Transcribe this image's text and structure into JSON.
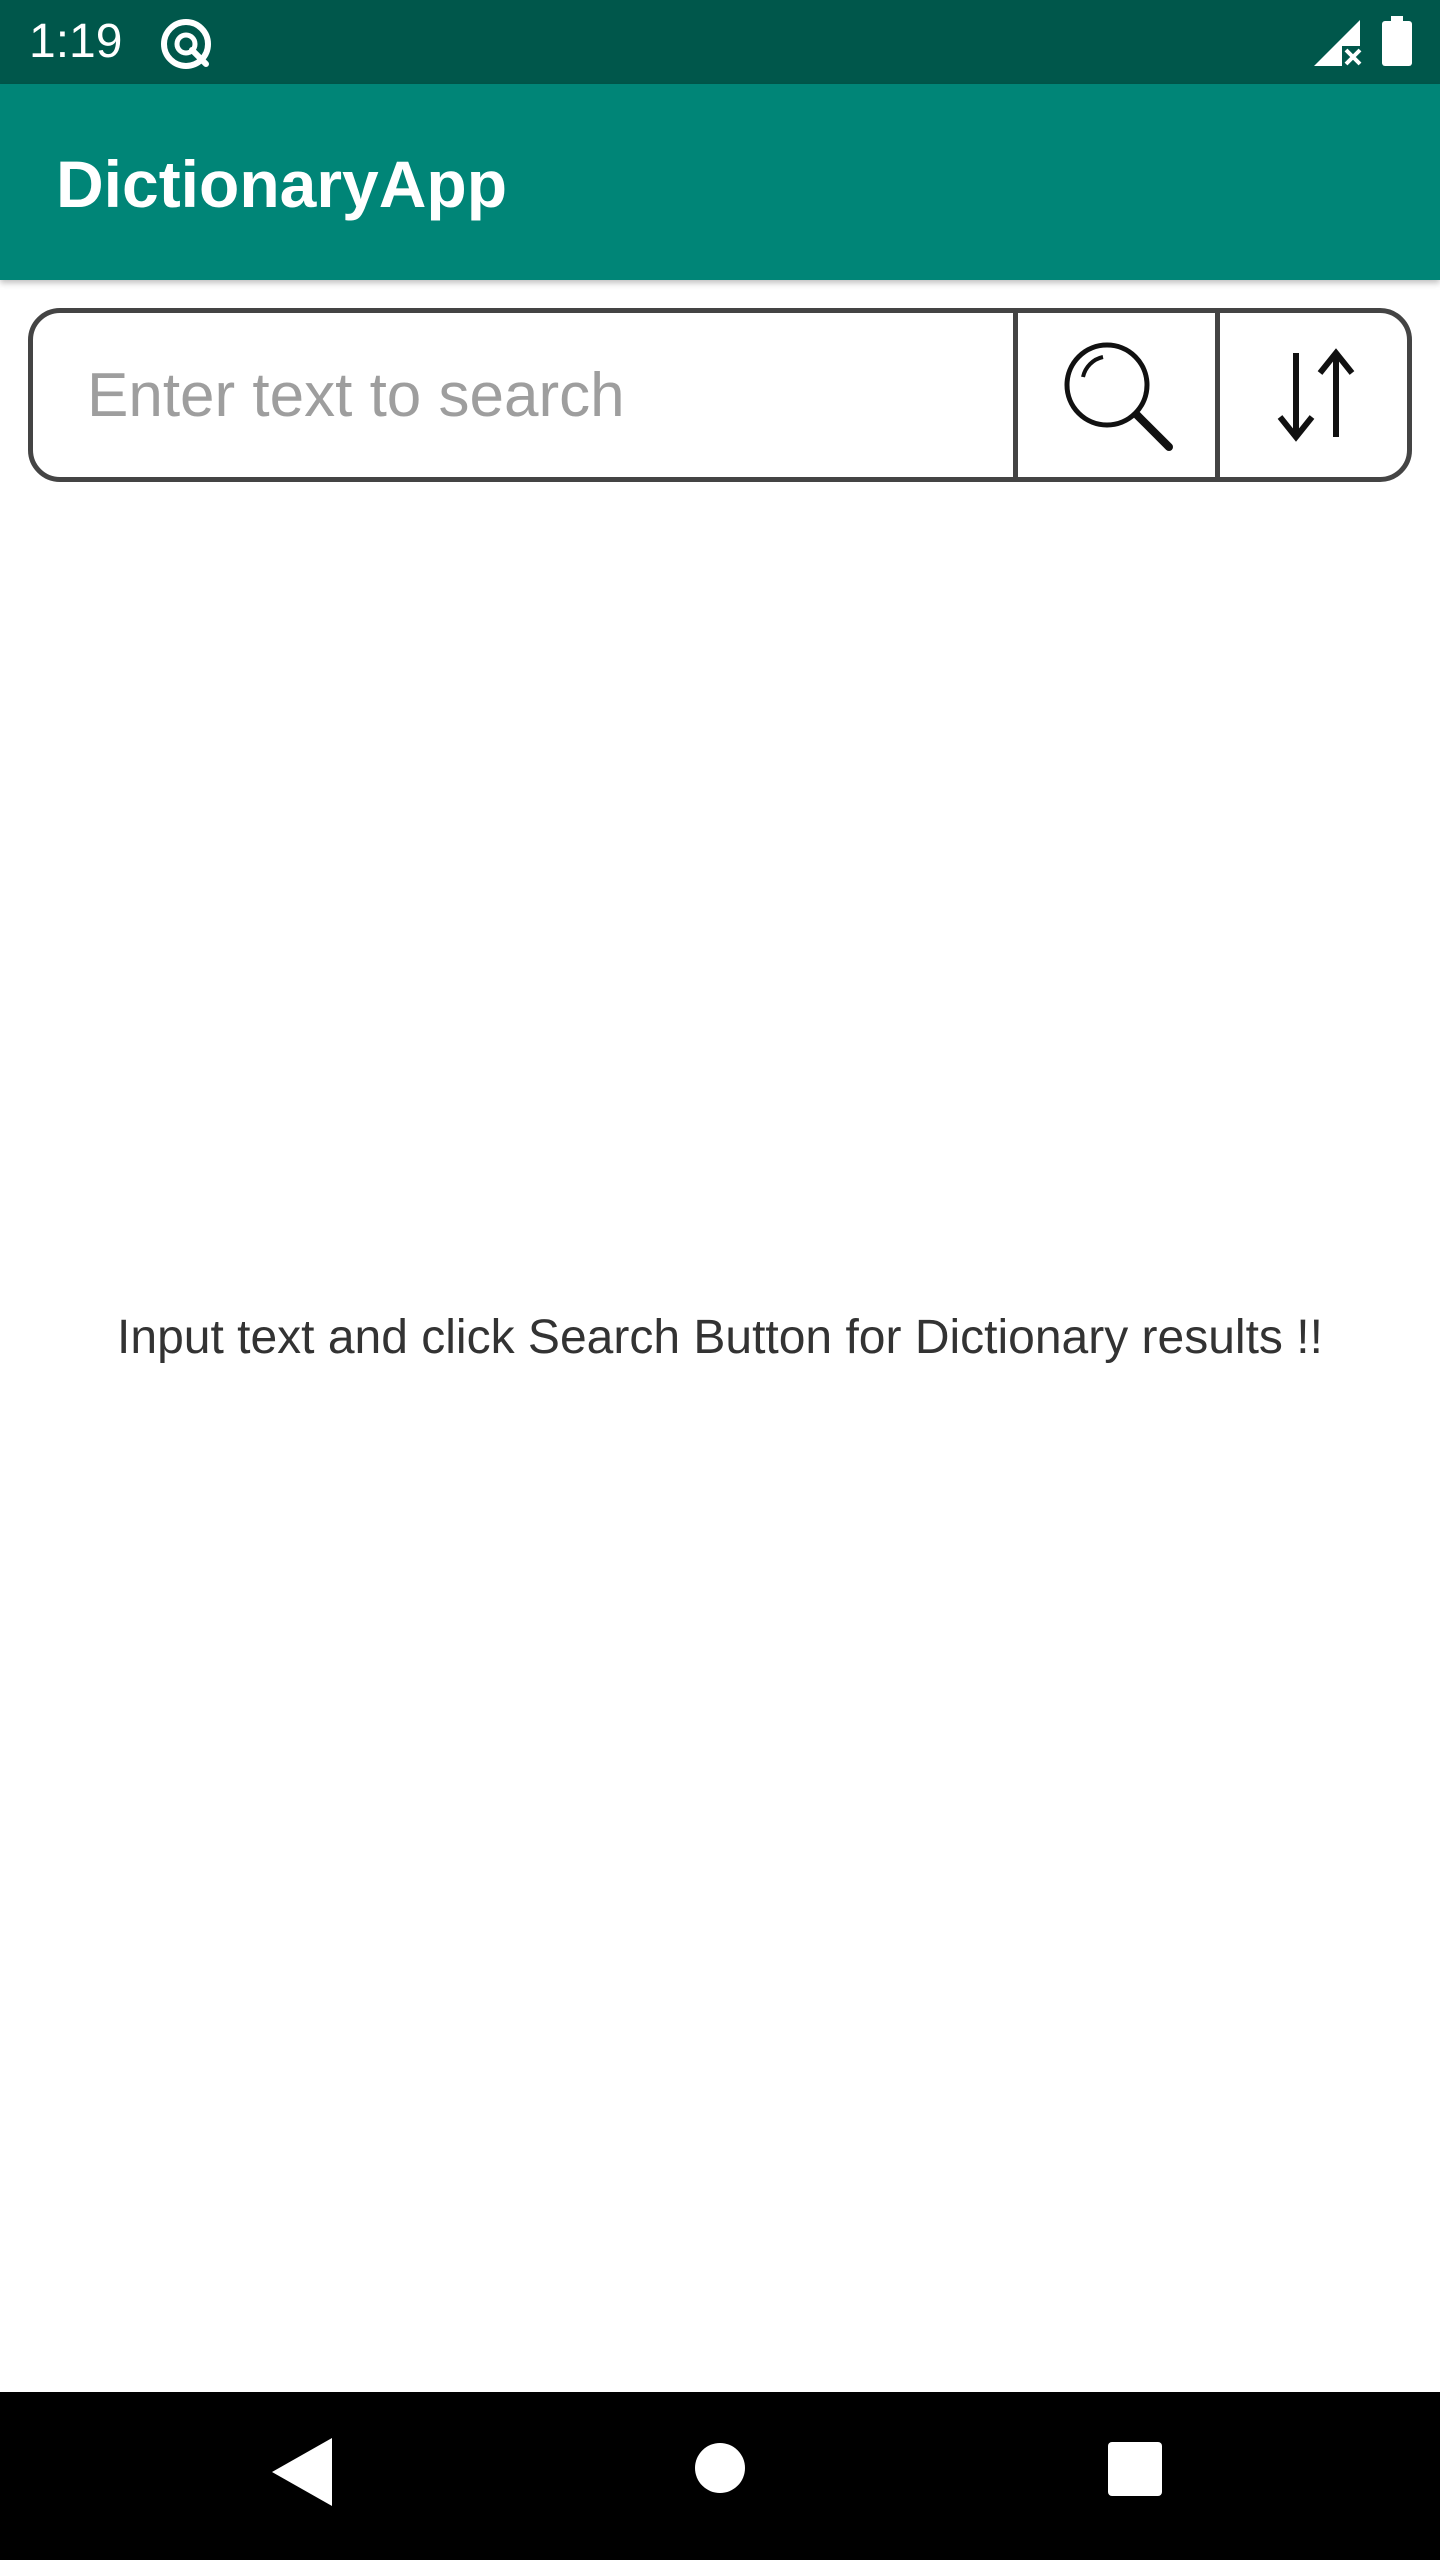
{
  "status_bar": {
    "time": "1:19",
    "icons": [
      "app-notification-icon",
      "signal-no-data-icon",
      "battery-full-icon"
    ]
  },
  "app_bar": {
    "title": "DictionaryApp",
    "color": "#008577",
    "status_color": "#00574B"
  },
  "search": {
    "value": "",
    "placeholder": "Enter text to search",
    "search_icon": "search-icon",
    "sort_icon": "sort-arrows-icon"
  },
  "main": {
    "empty_message": "Input text and click Search Button for Dictionary results !!"
  },
  "nav_bar": {
    "buttons": [
      "back-icon",
      "home-icon",
      "recents-icon"
    ]
  }
}
